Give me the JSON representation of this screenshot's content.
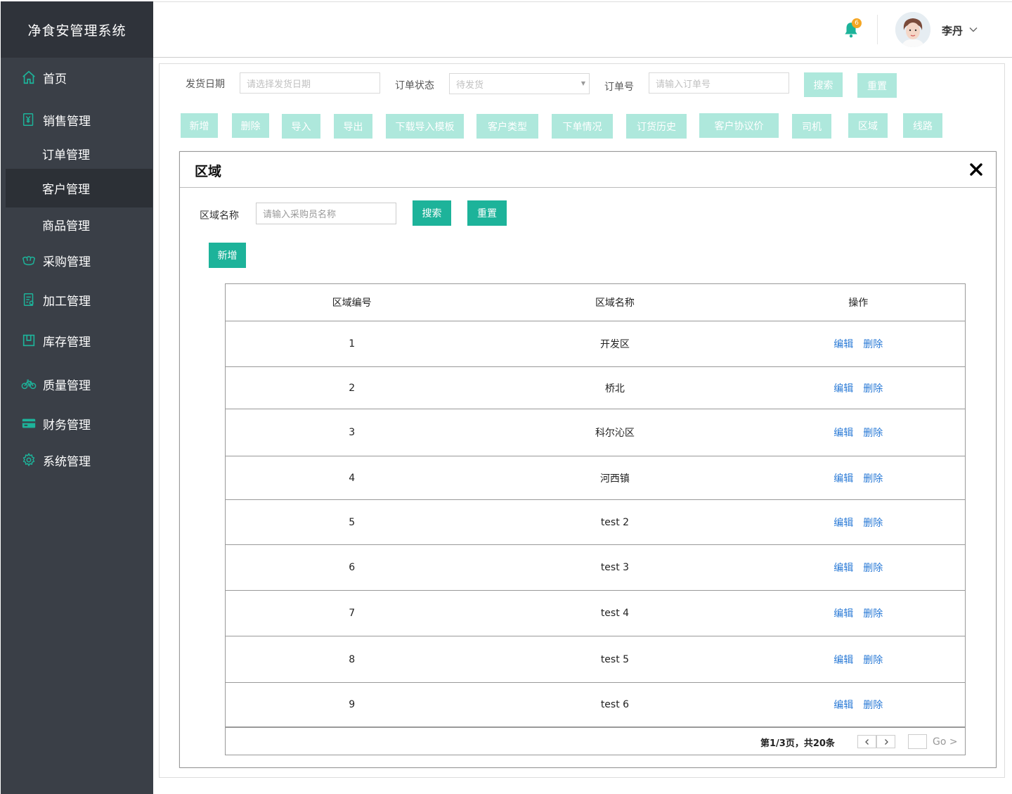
{
  "app": {
    "title": "净食安管理系统"
  },
  "sidebar": {
    "home": "首页",
    "sales": "销售管理",
    "sales_children": {
      "orders": "订单管理",
      "customers": "客户管理",
      "products": "商品管理"
    },
    "purchase": "采购管理",
    "processing": "加工管理",
    "inventory": "库存管理",
    "quality": "质量管理",
    "finance": "财务管理",
    "system": "系统管理"
  },
  "header": {
    "notification_count": "6",
    "user_name": "李丹"
  },
  "filters": {
    "ship_date_label": "发货日期",
    "ship_date_placeholder": "请选择发货日期",
    "status_label": "订单状态",
    "status_value": "待发货",
    "order_no_label": "订单号",
    "order_no_placeholder": "请输入订单号",
    "search": "搜索",
    "reset": "重置"
  },
  "toolbar": {
    "add": "新增",
    "delete": "删除",
    "import": "导入",
    "export": "导出",
    "download_template": "下载导入模板",
    "customer_type": "客户类型",
    "order_status": "下单情况",
    "order_history": "订货历史",
    "agreement_price": "客户协议价",
    "driver": "司机",
    "region": "区域",
    "route": "线路"
  },
  "modal": {
    "title": "区域",
    "name_label": "区域名称",
    "name_placeholder": "请输入采购员名称",
    "search": "搜索",
    "reset": "重置",
    "add": "新增",
    "table": {
      "headers": [
        "区域编号",
        "区域名称",
        "操作"
      ],
      "edit": "编辑",
      "delete": "删除",
      "rows": [
        {
          "id": "1",
          "name": "开发区"
        },
        {
          "id": "2",
          "name": "桥北"
        },
        {
          "id": "3",
          "name": "科尔沁区"
        },
        {
          "id": "4",
          "name": "河西镇"
        },
        {
          "id": "5",
          "name": "test 2"
        },
        {
          "id": "6",
          "name": "test 3"
        },
        {
          "id": "7",
          "name": "test 4"
        },
        {
          "id": "8",
          "name": "test 5"
        },
        {
          "id": "9",
          "name": "test 6"
        }
      ]
    },
    "pager": {
      "info": "第1/3页，共20条",
      "go": "Go >"
    }
  },
  "colors": {
    "primary": "#1db39a",
    "primary_light": "#aee8dc",
    "sidebar": "#3a3f47",
    "link": "#2a7ad6"
  }
}
